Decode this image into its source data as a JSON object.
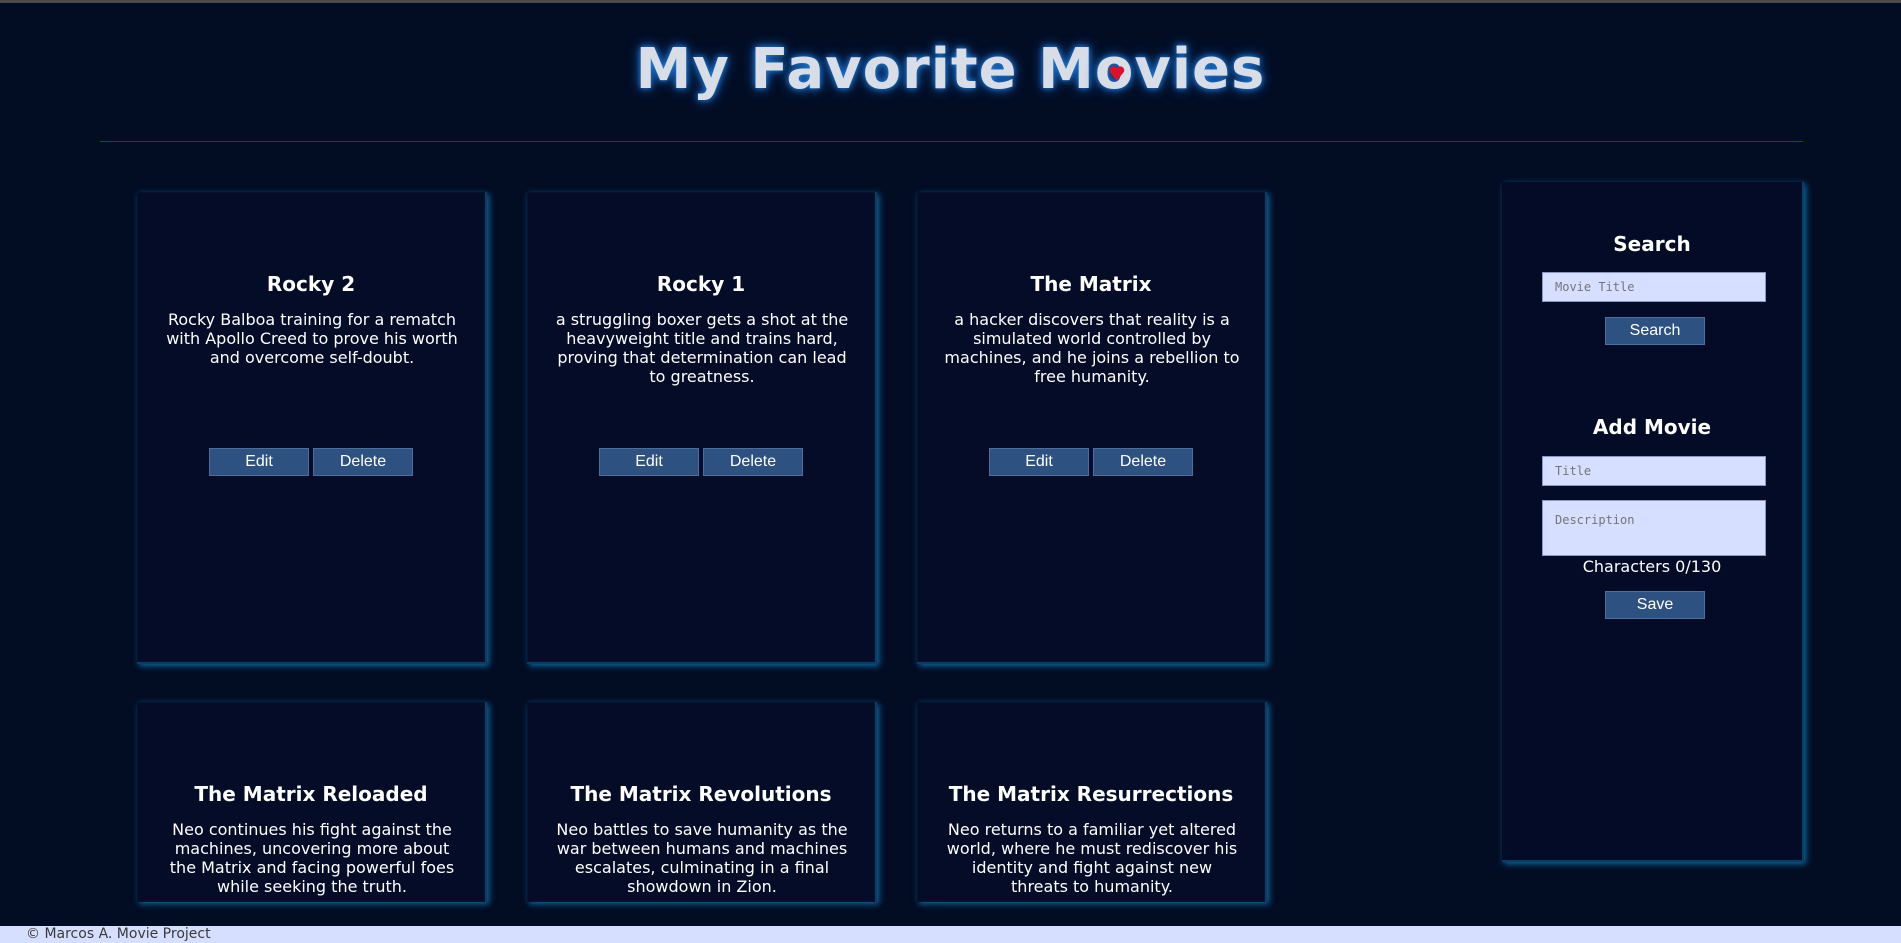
{
  "header": {
    "title_before": "My Favorite M",
    "title_o": "o",
    "title_after": "vies"
  },
  "movies": [
    {
      "title": "Rocky 2",
      "description": "Rocky Balboa training for a rematch with Apollo Creed to prove his worth and overcome self-doubt.",
      "edit_label": "Edit",
      "delete_label": "Delete"
    },
    {
      "title": "Rocky 1",
      "description": "a struggling boxer gets a shot at the heavyweight title and trains hard, proving that determination can lead to greatness.",
      "edit_label": "Edit",
      "delete_label": "Delete"
    },
    {
      "title": "The Matrix",
      "description": "a hacker discovers that reality is a simulated world controlled by machines, and he joins a rebellion to free humanity.",
      "edit_label": "Edit",
      "delete_label": "Delete"
    },
    {
      "title": "The Matrix Reloaded",
      "description": "Neo continues his fight against the machines, uncovering more about the Matrix and facing powerful foes while seeking the truth."
    },
    {
      "title": "The Matrix Revolutions",
      "description": "Neo battles to save humanity as the war between humans and machines escalates, culminating in a final showdown in Zion."
    },
    {
      "title": "The Matrix Resurrections",
      "description": "Neo returns to a familiar yet altered world, where he must rediscover his identity and fight against new threats to humanity."
    }
  ],
  "sidebar": {
    "search_heading": "Search",
    "search_placeholder": "Movie Title",
    "search_button": "Search",
    "add_heading": "Add Movie",
    "title_placeholder": "Title",
    "description_placeholder": "Description",
    "counter": "Characters 0/130",
    "save_button": "Save"
  },
  "footer": {
    "text": "© Marcos A. Movie Project"
  },
  "colors": {
    "background": "#020d24",
    "button": "#2d5282",
    "input": "#d6dfff",
    "heart": "#e0102a"
  }
}
